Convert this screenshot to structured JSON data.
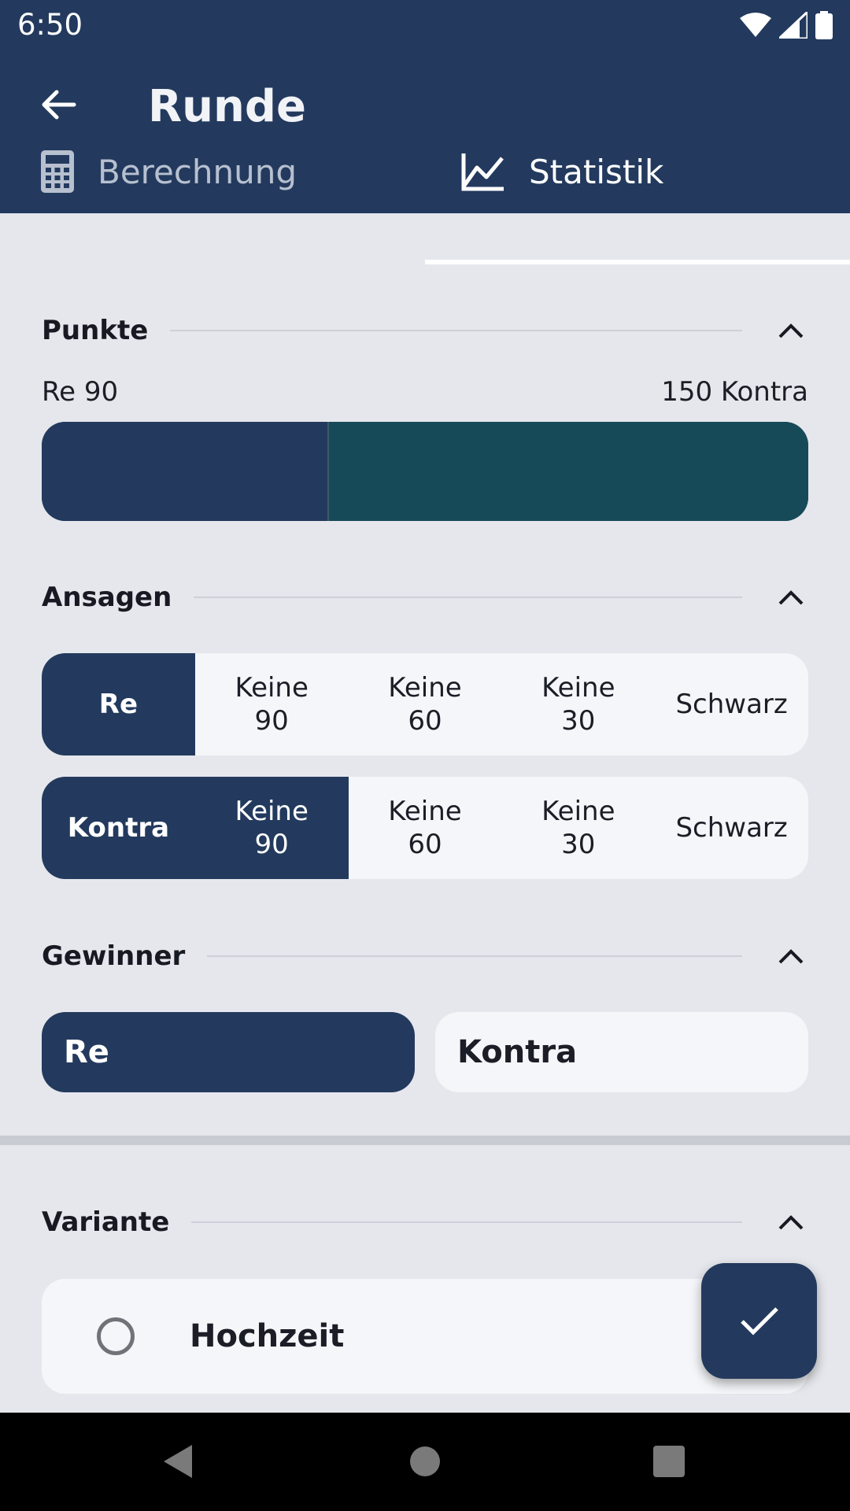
{
  "status_bar": {
    "time": "6:50",
    "icons": [
      "wifi-icon",
      "signal-icon",
      "battery-icon"
    ]
  },
  "app_bar": {
    "title": "Runde",
    "back_icon": "arrow-left-icon"
  },
  "tabs": [
    {
      "label": "Berechnung",
      "icon": "calculator-icon",
      "selected": false
    },
    {
      "label": "Statistik",
      "icon": "line-chart-icon",
      "selected": true
    }
  ],
  "sections": {
    "punkte": {
      "title": "Punkte",
      "re_label": "Re 90",
      "kontra_label": "150 Kontra",
      "re_points": 90,
      "kontra_points": 150
    },
    "ansagen": {
      "title": "Ansagen",
      "re_row": {
        "cells": [
          "Re",
          "Keine\n90",
          "Keine\n60",
          "Keine\n30",
          "Schwarz"
        ],
        "selected_count": 1
      },
      "kontra_row": {
        "cells": [
          "Kontra",
          "Keine\n90",
          "Keine\n60",
          "Keine\n30",
          "Schwarz"
        ],
        "selected_count": 2
      }
    },
    "gewinner": {
      "title": "Gewinner",
      "options": [
        "Re",
        "Kontra"
      ],
      "selected": "Re"
    },
    "variante": {
      "title": "Variante",
      "option_label": "Hochzeit",
      "option_selected": false
    }
  },
  "fab": {
    "icon": "check-icon"
  },
  "colors": {
    "primary": "#233a5e",
    "kontra_bar": "#174a58",
    "background": "#e6e7ec",
    "card": "#f5f6f9"
  }
}
